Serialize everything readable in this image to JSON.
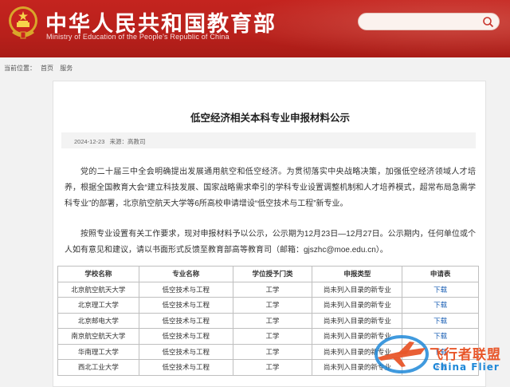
{
  "header": {
    "title": "中华人民共和国教育部",
    "subtitle": "Ministry of Education of the People's Republic of China",
    "search_placeholder": ""
  },
  "breadcrumb": {
    "label": "当前位置：",
    "items": [
      "首页",
      "服务"
    ]
  },
  "article": {
    "title": "低空经济相关本科专业申报材料公示",
    "date": "2024-12-23",
    "source_label": "来源：",
    "source": "高教司",
    "paragraphs": [
      "党的二十届三中全会明确提出发展通用航空和低空经济。为贯彻落实中央战略决策，加强低空经济领域人才培养，根据全国教育大会“建立科技发展、国家战略需求牵引的学科专业设置调整机制和人才培养模式，超常布局急需学科专业”的部署，北京航空航天大学等6所高校申请增设“低空技术与工程”新专业。",
      "按照专业设置有关工作要求，现对申报材料予以公示，公示期为12月23日—12月27日。公示期内，任何单位或个人如有意见和建议，请以书面形式反馈至教育部高等教育司（邮箱：gjszhc@moe.edu.cn）。"
    ]
  },
  "table": {
    "headers": [
      "学校名称",
      "专业名称",
      "学位授予门类",
      "申报类型",
      "申请表"
    ],
    "rows": [
      [
        "北京航空航天大学",
        "低空技术与工程",
        "工学",
        "尚未列入目录的新专业",
        "下载"
      ],
      [
        "北京理工大学",
        "低空技术与工程",
        "工学",
        "尚未列入目录的新专业",
        "下载"
      ],
      [
        "北京邮电大学",
        "低空技术与工程",
        "工学",
        "尚未列入目录的新专业",
        "下载"
      ],
      [
        "南京航空航天大学",
        "低空技术与工程",
        "工学",
        "尚未列入目录的新专业",
        "下载"
      ],
      [
        "华南理工大学",
        "低空技术与工程",
        "工学",
        "尚未列入目录的新专业",
        "下载"
      ],
      [
        "西北工业大学",
        "低空技术与工程",
        "工学",
        "尚未列入目录的新专业",
        "下载"
      ]
    ]
  },
  "watermark": {
    "text_cn": "飞行者联盟",
    "text_en": "China Flier"
  },
  "colors": {
    "header_red": "#b8201b",
    "link_blue": "#1a5fb4",
    "watermark_orange": "#e8562a",
    "watermark_blue": "#1e88d8"
  },
  "icons": [
    "national-emblem-icon",
    "search-icon",
    "plane-logo-icon"
  ]
}
